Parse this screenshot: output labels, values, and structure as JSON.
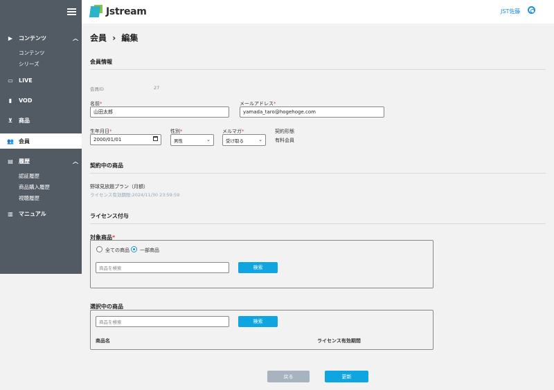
{
  "brand": {
    "logo_text": "Jstream"
  },
  "header": {
    "user_name": "JST佐藤"
  },
  "sidebar": {
    "items": [
      {
        "label": "コンテンツ",
        "icon": "play-circle-icon"
      },
      {
        "label": "LIVE",
        "icon": "video-icon"
      },
      {
        "label": "VOD",
        "icon": "film-icon"
      },
      {
        "label": "商品",
        "icon": "cart-icon"
      },
      {
        "label": "会員",
        "icon": "users-icon"
      },
      {
        "label": "履歴",
        "icon": "history-icon"
      },
      {
        "label": "マニュアル",
        "icon": "book-icon"
      }
    ],
    "content_sub": [
      "コンテンツ",
      "シリーズ"
    ],
    "history_sub": [
      "認証履歴",
      "商品購入履歴",
      "視聴履歴"
    ]
  },
  "page": {
    "breadcrumb_parent": "会員",
    "breadcrumb_sep": "›",
    "breadcrumb_current": "編集"
  },
  "member_info": {
    "title": "会員情報",
    "id_label": "会員ID",
    "id_value": "27",
    "name_label": "名前",
    "name_value": "山田太郎",
    "email_label": "メールアドレス",
    "email_value": "yamada_taro@hogehoge.com",
    "birthday_label": "生年月日",
    "birthday_value": "2000/01/01",
    "gender_label": "性別",
    "gender_value": "男性",
    "mailmag_label": "メルマガ",
    "mailmag_value": "受け取る",
    "contract_label": "契約形態",
    "contract_value": "有料会員",
    "required_mark": "*"
  },
  "contracted": {
    "title": "契約中の商品",
    "product_name": "野球見放題プラン（月額）",
    "license_text": "ライセンス有効期限:2024/11/30 23:59:59"
  },
  "license": {
    "title": "ライセンス付与",
    "target_label": "対象商品",
    "radio_all": "全ての商品",
    "radio_partial": "一部商品",
    "search_placeholder": "商品を検索",
    "search_button": "検索"
  },
  "selected": {
    "title": "選択中の商品",
    "search_placeholder": "商品を検索",
    "search_button": "検索",
    "col_product": "商品名",
    "col_license": "ライセンス有効期間"
  },
  "actions": {
    "back": "戻る",
    "update": "更新"
  },
  "colors": {
    "accent": "#0ea5e0",
    "sidebar": "#525a63",
    "required": "#e53935"
  }
}
